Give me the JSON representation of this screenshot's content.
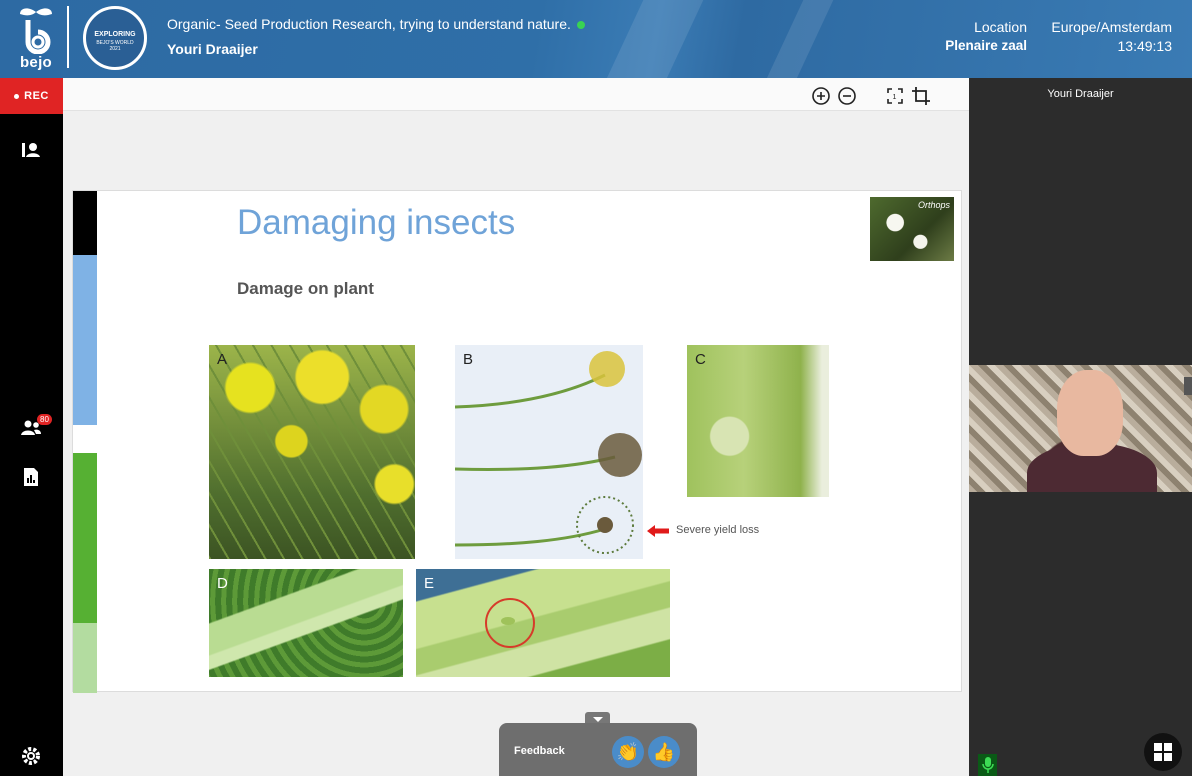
{
  "header": {
    "logo_text": "bejo",
    "badge": {
      "line1": "EXPLORING",
      "line2": "BEJO'S WORLD",
      "line3": "2021",
      "binary": "0101 010101"
    },
    "session_title": "Organic- Seed Production Research, trying to understand nature.",
    "presenter": "Youri Draaijer",
    "location_label": "Location",
    "location_value": "Plenaire zaal",
    "timezone": "Europe/Amsterdam",
    "time": "13:49:13"
  },
  "sidebar": {
    "rec_label": "REC",
    "attendee_count": "80",
    "icons": [
      "presenter-icon",
      "attendees-icon",
      "report-icon",
      "settings-icon"
    ]
  },
  "toolbar": {
    "icons": [
      "zoom-in-icon",
      "zoom-out-icon",
      "fit-screen-icon",
      "crop-icon"
    ]
  },
  "slide": {
    "title": "Damaging insects",
    "subtitle": "Damage on plant",
    "corner_caption": "Orthops",
    "photos": [
      {
        "label": "A"
      },
      {
        "label": "B"
      },
      {
        "label": "C"
      },
      {
        "label": "D"
      },
      {
        "label": "E"
      }
    ],
    "annotation": "Severe  yield loss",
    "accent_colors": [
      "#000000",
      "#7fb2e5",
      "#ffffff",
      "#56b033",
      "#b3dca0"
    ]
  },
  "feedback": {
    "label": "Feedback",
    "buttons": [
      "clap-icon",
      "thumbs-up-icon"
    ]
  },
  "participants": {
    "name": "Youri Draaijer"
  },
  "colors": {
    "header_bg": "#2f6fa8",
    "rec_red": "#e02424",
    "title_blue": "#6fa3d8",
    "live_green": "#39d353"
  }
}
